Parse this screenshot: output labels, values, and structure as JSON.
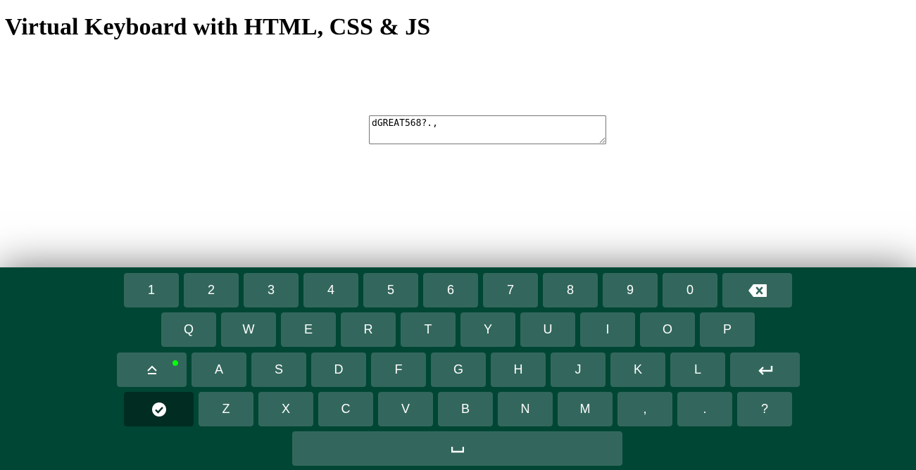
{
  "page": {
    "title": "Virtual Keyboard with HTML, CSS & JS"
  },
  "input": {
    "value": "dGREAT568?.,"
  },
  "keyboard": {
    "colors": {
      "background": "#004634",
      "key": "#33675d",
      "key_active": "#002c22",
      "caps_indicator": "#08ff08",
      "text": "#ffffff"
    },
    "rows": [
      {
        "keys": [
          {
            "label": "1"
          },
          {
            "label": "2"
          },
          {
            "label": "3"
          },
          {
            "label": "4"
          },
          {
            "label": "5"
          },
          {
            "label": "6"
          },
          {
            "label": "7"
          },
          {
            "label": "8"
          },
          {
            "label": "9"
          },
          {
            "label": "0"
          },
          {
            "label": "",
            "icon": "backspace-icon",
            "wide": true
          }
        ]
      },
      {
        "keys": [
          {
            "label": "Q"
          },
          {
            "label": "W"
          },
          {
            "label": "E"
          },
          {
            "label": "R"
          },
          {
            "label": "T"
          },
          {
            "label": "Y"
          },
          {
            "label": "U"
          },
          {
            "label": "I"
          },
          {
            "label": "O"
          },
          {
            "label": "P"
          }
        ]
      },
      {
        "keys": [
          {
            "label": "",
            "icon": "caps-lock-icon",
            "wide": true,
            "indicator_on": true
          },
          {
            "label": "A"
          },
          {
            "label": "S"
          },
          {
            "label": "D"
          },
          {
            "label": "F"
          },
          {
            "label": "G"
          },
          {
            "label": "H"
          },
          {
            "label": "J"
          },
          {
            "label": "K"
          },
          {
            "label": "L"
          },
          {
            "label": "",
            "icon": "enter-icon",
            "wide": true
          }
        ]
      },
      {
        "keys": [
          {
            "label": "",
            "icon": "done-check-icon",
            "wide": true,
            "active": true
          },
          {
            "label": "Z"
          },
          {
            "label": "X"
          },
          {
            "label": "C"
          },
          {
            "label": "V"
          },
          {
            "label": "B"
          },
          {
            "label": "N"
          },
          {
            "label": "M"
          },
          {
            "label": ","
          },
          {
            "label": "."
          },
          {
            "label": "?"
          }
        ]
      },
      {
        "keys": [
          {
            "label": "",
            "icon": "space-bar-icon",
            "space": true
          }
        ]
      }
    ]
  }
}
